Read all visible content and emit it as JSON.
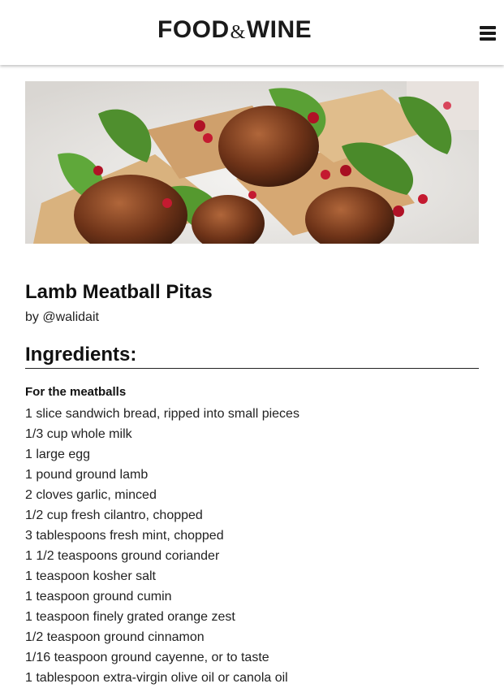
{
  "header": {
    "logo_food": "FOOD",
    "logo_amp": "&",
    "logo_wine": "WINE",
    "menu_icon": "hamburger-menu-icon"
  },
  "hero": {
    "image": "lamb-meatball-pitas-photo"
  },
  "recipe": {
    "title": "Lamb Meatball Pitas",
    "byline": "by @walidait"
  },
  "ingredients": {
    "heading": "Ingredients:",
    "subheading": "For the meatballs",
    "items": [
      "1 slice sandwich bread, ripped into small pieces",
      "1/3 cup whole milk",
      "1 large egg",
      "1 pound ground lamb",
      "2 cloves garlic, minced",
      "1/2 cup fresh cilantro, chopped",
      "3 tablespoons fresh mint, chopped",
      "1 1/2 teaspoons ground coriander",
      "1 teaspoon kosher salt",
      "1 teaspoon ground cumin",
      "1 teaspoon finely grated orange zest",
      "1/2 teaspoon ground cinnamon",
      "1/16 teaspoon ground cayenne, or to taste",
      "1 tablespoon extra-virgin olive oil or canola oil"
    ]
  }
}
